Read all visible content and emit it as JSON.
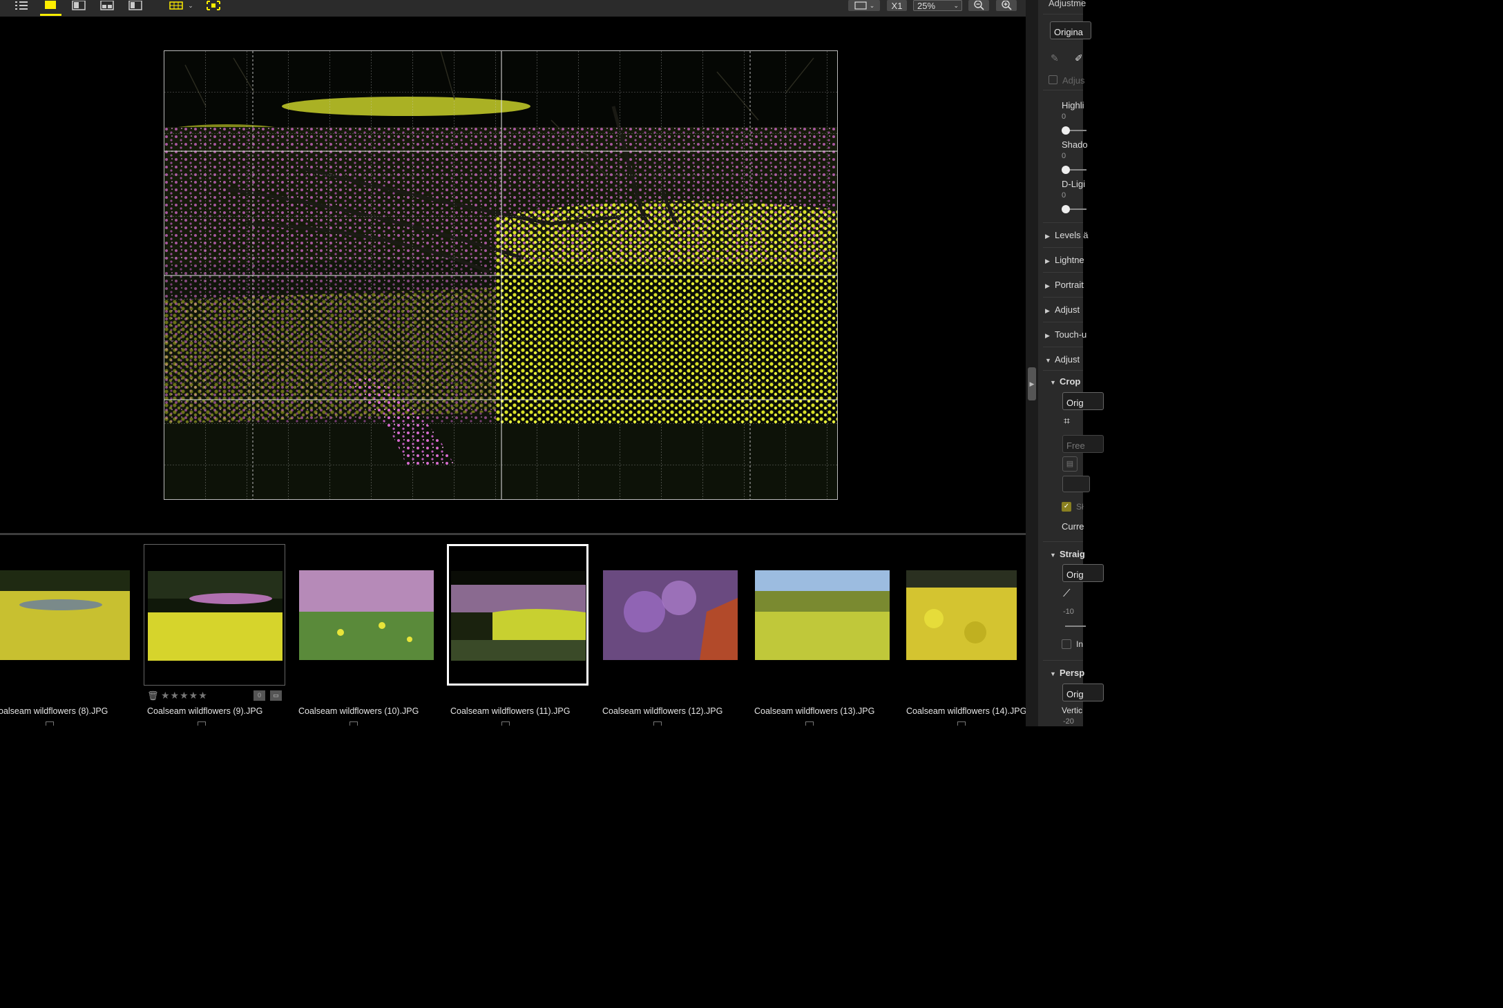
{
  "toolbar": {
    "zoom_value": "25%",
    "x1_label": "X1",
    "active_color": "#ffee00"
  },
  "panel": {
    "title": "Adjustme",
    "preset_select": "Origina",
    "adjust_checkbox": "Adjus",
    "sliders": [
      {
        "label": "Highli",
        "value": "0"
      },
      {
        "label": "Shado",
        "value": "0"
      },
      {
        "label": "D-Ligi",
        "value": "0"
      }
    ],
    "collapsed_sections": [
      "Levels ä",
      "Lightne",
      "Portrait",
      "Adjust",
      "Touch-u"
    ],
    "expanded_section": "Adjust",
    "crop": {
      "title": "Crop",
      "select": "Orig",
      "ratio_select": "Free",
      "checkbox_label": "Sł",
      "current_label": "Curre"
    },
    "straighten": {
      "title": "Straig",
      "select": "Orig",
      "value": "-10",
      "checkbox_label": "In"
    },
    "perspective": {
      "title": "Persp",
      "select": "Orig",
      "vertical_label": "Vertic",
      "vertical_value": "-20"
    }
  },
  "filmstrip": {
    "items": [
      {
        "name": "oalseam wildflowers (8).JPG"
      },
      {
        "name": "Coalseam wildflowers (9).JPG"
      },
      {
        "name": "Coalseam wildflowers (10).JPG"
      },
      {
        "name": "Coalseam wildflowers (11).JPG"
      },
      {
        "name": "Coalseam wildflowers (12).JPG"
      },
      {
        "name": "Coalseam wildflowers (13).JPG"
      },
      {
        "name": "Coalseam wildflowers (14).JPG"
      }
    ],
    "rating_stars": "★★★★★",
    "label_badge": "0",
    "selected_index": 3
  }
}
